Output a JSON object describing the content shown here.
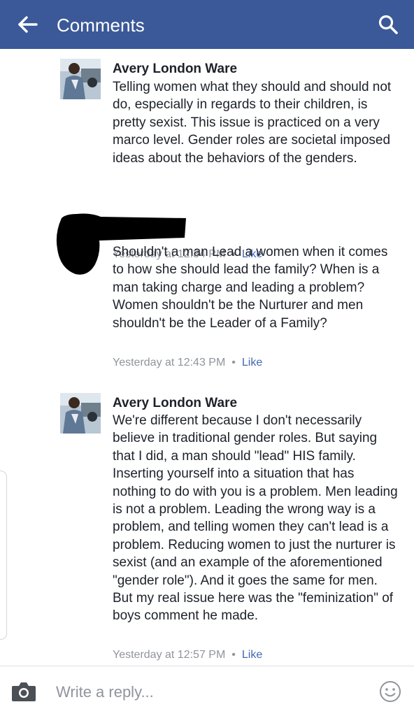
{
  "header": {
    "title": "Comments",
    "bg_color": "#3b5998",
    "back_icon": "arrow-left-icon",
    "search_icon": "search-icon"
  },
  "comments": [
    {
      "author": "Avery London Ware",
      "text": "Telling women what they should and should not do, especially in regards to their children, is pretty sexist. This issue is practiced on a very marco level. Gender roles are societal imposed ideas about the behaviors of the genders.",
      "time": "Yesterday at 12:34 PM",
      "like": "Like"
    },
    {
      "author": "",
      "text": "Shouldn't a man Lead a women when it comes to how she should lead the family? When is a man taking charge and leading a problem? Women shouldn't be the Nurturer and men shouldn't be the Leader of a Family?",
      "time": "Yesterday at 12:43 PM",
      "like": "Like"
    },
    {
      "author": "Avery London Ware",
      "text": "We're different because I don't necessarily believe in traditional gender roles. But saying that I did, a man should \"lead\" HIS family. Inserting yourself into a situation that has nothing to do with you is a problem. Men leading is not a problem. Leading the wrong way is a problem, and telling women they can't lead is a problem. Reducing women to just the nurturer is sexist (and an example of the aforementioned \"gender role\"). And it goes the same for men. But my real issue here was the \"feminization\" of boys comment he made.",
      "time": "Yesterday at 12:57 PM",
      "like": "Like"
    }
  ],
  "composer": {
    "placeholder": "Write a reply...",
    "camera_icon": "camera-icon",
    "emoji_icon": "smiley-icon"
  },
  "colors": {
    "link": "#4267b2",
    "meta": "#90949c",
    "text": "#1d2129"
  }
}
